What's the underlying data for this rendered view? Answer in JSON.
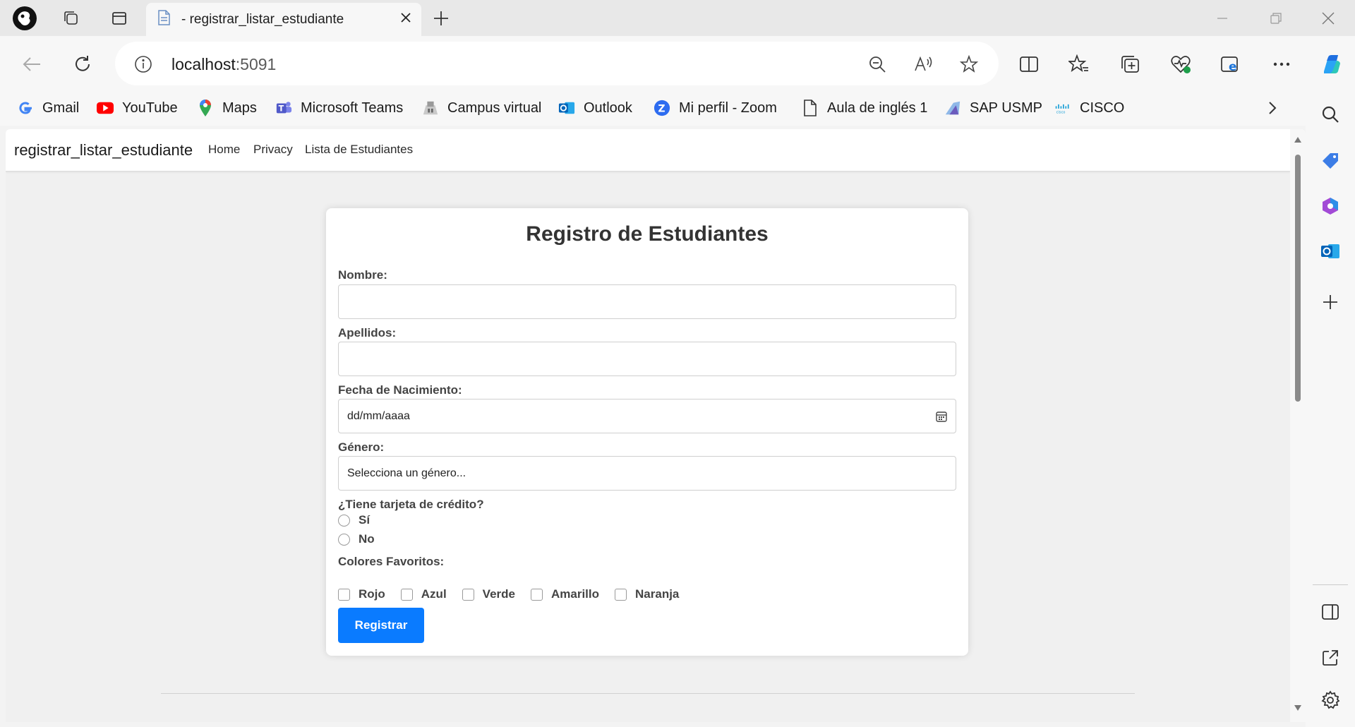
{
  "browser": {
    "tab_title": "- registrar_listar_estudiante",
    "url_host": "localhost",
    "url_port": ":5091"
  },
  "favorites": [
    {
      "label": "Gmail",
      "icon": "google-icon"
    },
    {
      "label": "YouTube",
      "icon": "youtube-icon"
    },
    {
      "label": "Maps",
      "icon": "maps-icon"
    },
    {
      "label": "Microsoft Teams",
      "icon": "teams-icon"
    },
    {
      "label": "Campus virtual",
      "icon": "campus-icon"
    },
    {
      "label": "Outlook",
      "icon": "outlook-icon"
    },
    {
      "label": "Mi perfil - Zoom",
      "icon": "zoom-icon"
    },
    {
      "label": "Aula de inglés 1",
      "icon": "page-icon"
    },
    {
      "label": "SAP USMP",
      "icon": "sap-icon"
    },
    {
      "label": "CISCO",
      "icon": "cisco-icon"
    }
  ],
  "site": {
    "brand": "registrar_listar_estudiante",
    "nav": [
      "Home",
      "Privacy",
      "Lista de Estudiantes"
    ]
  },
  "form": {
    "title": "Registro de Estudiantes",
    "nombre_label": "Nombre:",
    "nombre_value": "",
    "apellidos_label": "Apellidos:",
    "apellidos_value": "",
    "fecha_label": "Fecha de Nacimiento:",
    "fecha_placeholder": "dd/mm/aaaa",
    "genero_label": "Género:",
    "genero_selected": "Selecciona un género...",
    "tarjeta_label": "¿Tiene tarjeta de crédito?",
    "tarjeta_options": [
      "Sí",
      "No"
    ],
    "colores_label": "Colores Favoritos:",
    "colores_options": [
      "Rojo",
      "Azul",
      "Verde",
      "Amarillo",
      "Naranja"
    ],
    "submit_label": "Registrar"
  },
  "colors": {
    "accent": "#0a7bff",
    "page_bg": "#f0f0f0"
  }
}
